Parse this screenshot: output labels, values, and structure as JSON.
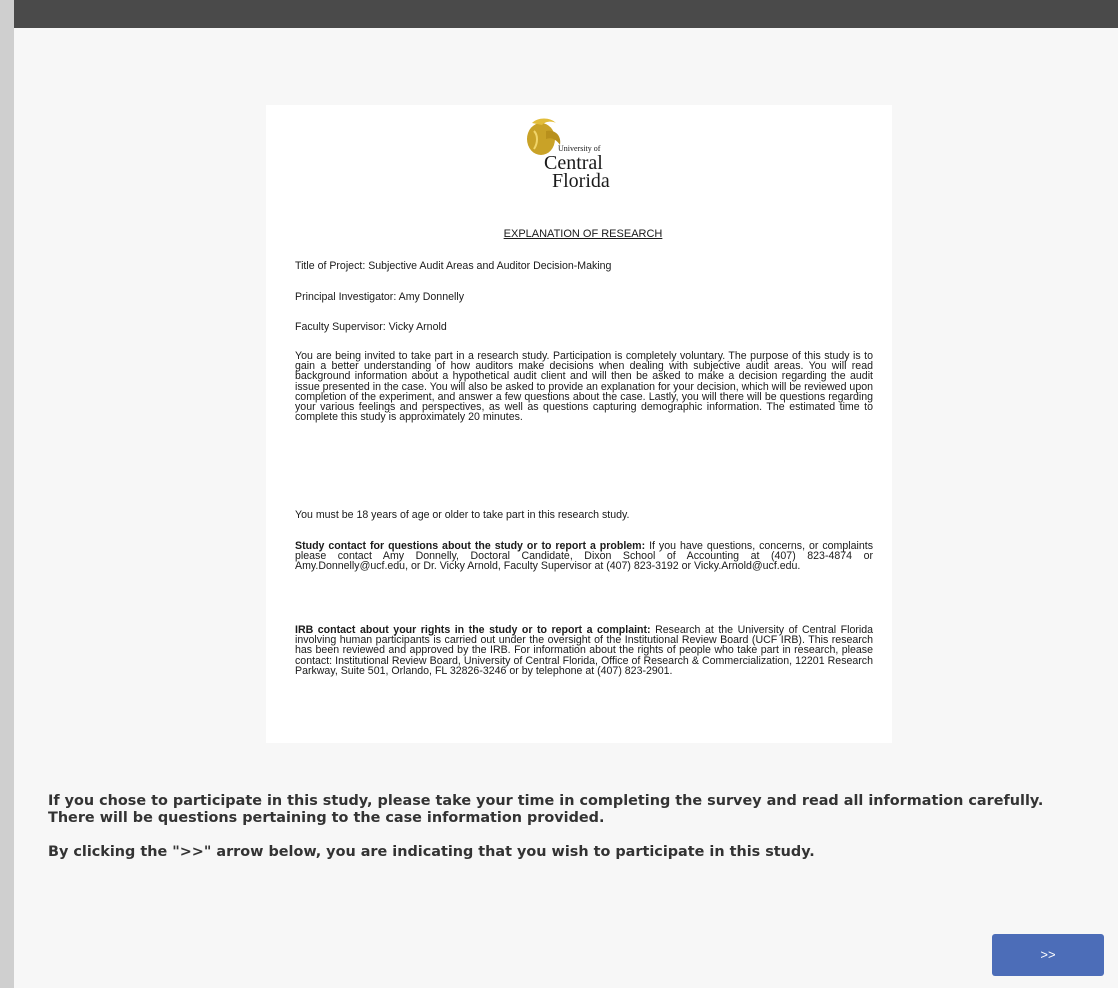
{
  "document": {
    "logo": {
      "university_of": "University of",
      "central": "Central",
      "florida": "Florida"
    },
    "heading": "EXPLANATION OF RESEARCH",
    "title_of_project": "Title of Project: Subjective Audit Areas and Auditor Decision-Making",
    "principal_investigator": "Principal Investigator: Amy Donnelly",
    "faculty_supervisor": "Faculty Supervisor: Vicky Arnold",
    "invitation_paragraph": "You are being invited to take part in a research study. Participation is completely voluntary. The purpose of this study is to gain a better understanding of how auditors make decisions when dealing with subjective audit areas. You will read background information about a hypothetical audit client and will then be asked to make a decision regarding the audit issue presented in the case. You will also be asked to provide an explanation for your decision, which will be reviewed upon completion of the experiment, and answer a few questions about the case. Lastly, you will there will be questions regarding your various feelings and perspectives, as well as questions capturing demographic information. The estimated time to complete this study is approximately 20 minutes.",
    "age_requirement": "You must be 18 years of age or older to take part in this research study.",
    "study_contact_label": "Study contact for questions about the study or to report a problem:",
    "study_contact_text": " If you have questions, concerns, or complaints please contact Amy Donnelly, Doctoral Candidate, Dixon School of Accounting at (407) 823-4874  or Amy.Donnelly@ucf.edu, or Dr. Vicky Arnold, Faculty Supervisor at (407) 823-3192 or Vicky.Arnold@ucf.edu.",
    "irb_contact_label": "IRB contact about your rights in the study or to report a complaint:",
    "irb_contact_text": " Research at the University of Central Florida involving human participants is carried out under the oversight of the Institutional Review Board (UCF IRB). This research has been reviewed and approved by the IRB. For information about the rights of people who take part in research, please contact: Institutional Review Board, University of Central Florida, Office of Research & Commercialization, 12201 Research Parkway, Suite 501, Orlando, FL 32826-3246 or by telephone at (407) 823-2901."
  },
  "instructions": {
    "paragraph_1": "If you chose to participate in this study, please take your time in completing the survey and read all information carefully. There will be questions pertaining to the case information provided.",
    "paragraph_2": "By clicking the \">>\" arrow below, you are indicating that you wish to participate in this study."
  },
  "navigation": {
    "next_label": ">>"
  },
  "colors": {
    "top_bar": "#4a4a4a",
    "next_button": "#4c6db8",
    "logo_gold": "#c9a227"
  }
}
